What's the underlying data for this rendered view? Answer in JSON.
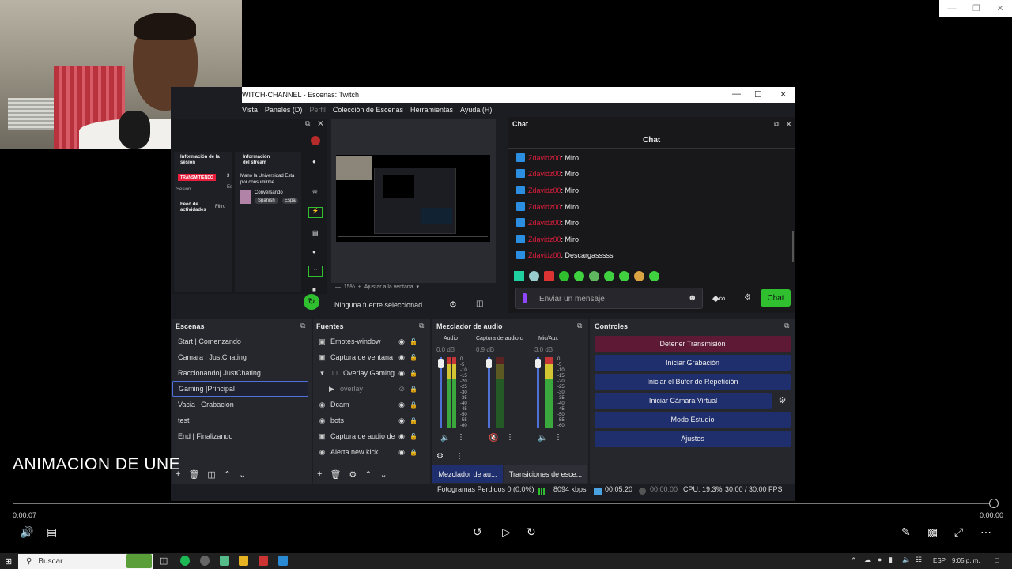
{
  "webcam": {
    "label": "webcam-feed"
  },
  "window": {
    "title": "WITCH-CHANNEL - Escenas: Twitch",
    "menu": [
      "Vista",
      "Paneles (D)",
      "Perfil",
      "Colección de Escenas",
      "Herramientas",
      "Ayuda (H)"
    ]
  },
  "session": {
    "info_title": "Información de la sesión",
    "stream_title": "Información del stream",
    "live_badge": "TRANSMITIENDO",
    "count": "3",
    "session_label": "Sesión",
    "es_label": "Es",
    "stream_name": "Mano la Universidad Esta por consumirme...",
    "category": "Conversando",
    "tag1": "Spanish",
    "tag2": "Espa",
    "feed_title": "Feed de actividades",
    "filter": "Filtro"
  },
  "preview": {
    "zoom": "15%",
    "fit": "Ajustar a la ventana",
    "no_source": "Ninguna fuente seleccionad"
  },
  "chat": {
    "dock_title": "Chat",
    "title": "Chat",
    "messages": [
      {
        "user": "Zdavidz00",
        "text": ": Miro"
      },
      {
        "user": "Zdavidz00",
        "text": ": Miro"
      },
      {
        "user": "Zdavidz00",
        "text": ": Miro"
      },
      {
        "user": "Zdavidz00",
        "text": ": Miro"
      },
      {
        "user": "Zdavidz00",
        "text": ": Miro"
      },
      {
        "user": "Zdavidz00",
        "text": ": Miro"
      },
      {
        "user": "Zdavidz00",
        "text": ": Descargasssss"
      }
    ],
    "input_placeholder": "Enviar un mensaje",
    "send_label": "Chat"
  },
  "scenes": {
    "title": "Escenas",
    "items": [
      "Start | Comenzando",
      "Camara | JustChating",
      "Raccionando| JustChating",
      "Gaming |Principal",
      "Vacia | Grabacion",
      "test",
      "End | Finalizando"
    ],
    "selected_index": 3
  },
  "sources": {
    "title": "Fuentes",
    "items": [
      {
        "name": "Emotes-window",
        "icon": "window-icon"
      },
      {
        "name": "Captura de ventana",
        "icon": "window-icon"
      },
      {
        "name": "Overlay Gaming",
        "icon": "folder-icon"
      },
      {
        "name": "overlay",
        "icon": "play-icon"
      },
      {
        "name": "Dcam",
        "icon": "camera-icon"
      },
      {
        "name": "bots",
        "icon": "browser-icon"
      },
      {
        "name": "Captura de audio de",
        "icon": "window-icon"
      },
      {
        "name": "Alerta new kick",
        "icon": "browser-icon"
      }
    ]
  },
  "mixer": {
    "title": "Mezclador de audio",
    "channels": [
      {
        "name": "Audio",
        "db": "0.0 dB"
      },
      {
        "name": "Captura de audio c",
        "db": "0.9 dB"
      },
      {
        "name": "Mic/Aux",
        "db": "3.0 dB"
      }
    ],
    "ticks": [
      "0",
      "-5",
      "-10",
      "-15",
      "-20",
      "-25",
      "-30",
      "-35",
      "-40",
      "-45",
      "-50",
      "-55",
      "-60"
    ],
    "tab_mixer": "Mezclador de au...",
    "tab_transitions": "Transiciones de esce..."
  },
  "controls": {
    "title": "Controles",
    "stop": "Detener Transmisión",
    "record": "Iniciar Grabación",
    "replay": "Iniciar el Búfer de Repetición",
    "vcam": "Iniciar Cámara Virtual",
    "studio": "Modo Estudio",
    "settings": "Ajustes"
  },
  "status": {
    "dropped": "Fotogramas Perdidos 0 (0.0%)",
    "bitrate": "8094 kbps",
    "live_time": "00:05:20",
    "rec_time": "00:00:00",
    "cpu": "CPU: 19.3%",
    "fps": "30.00 / 30.00 FPS"
  },
  "overlay_caption": "ANIMACION DE UNE",
  "player": {
    "current": "0:00:07",
    "total": "0:00:00"
  },
  "taskbar": {
    "search": "Buscar",
    "lang": "ESP",
    "time": "9:05 p. m."
  },
  "colors": {
    "accent": "#4f71d7",
    "stop_btn": "#5e1a34",
    "ctrl_btn": "#1f2f6e",
    "chat_send": "#2fbf2f",
    "chat_user": "#e01e3c"
  }
}
